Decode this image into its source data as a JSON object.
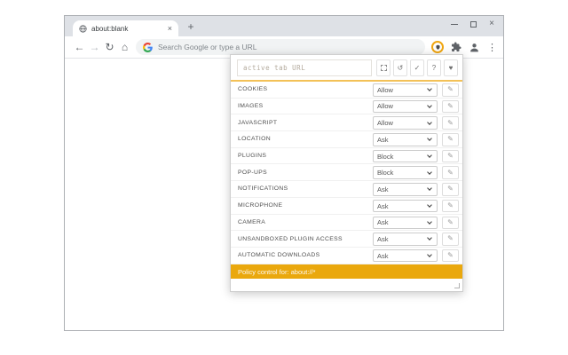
{
  "window": {
    "tab": {
      "title": "about:blank",
      "close_glyph": "×",
      "new_tab_glyph": "+"
    },
    "controls": {
      "close_glyph": "×"
    },
    "toolbar": {
      "back_glyph": "←",
      "forward_glyph": "→",
      "reload_glyph": "↻",
      "home_glyph": "⌂",
      "omnibox_placeholder": "Search Google or type a URL",
      "menu_glyph": "⋮"
    }
  },
  "popup": {
    "url_input": {
      "value": "",
      "placeholder": "active tab URL"
    },
    "header_buttons": {
      "reset_glyph": "↺",
      "confirm_glyph": "✓",
      "help_glyph": "?",
      "favorite_glyph": "♥"
    },
    "rows": [
      {
        "id": "cookies",
        "label": "COOKIES",
        "value": "Allow"
      },
      {
        "id": "images",
        "label": "IMAGES",
        "value": "Allow"
      },
      {
        "id": "javascript",
        "label": "JAVASCRIPT",
        "value": "Allow"
      },
      {
        "id": "location",
        "label": "LOCATION",
        "value": "Ask"
      },
      {
        "id": "plugins",
        "label": "PLUGINS",
        "value": "Block"
      },
      {
        "id": "popups",
        "label": "POP-UPS",
        "value": "Block"
      },
      {
        "id": "notifications",
        "label": "NOTIFICATIONS",
        "value": "Ask"
      },
      {
        "id": "microphone",
        "label": "MICROPHONE",
        "value": "Ask"
      },
      {
        "id": "camera",
        "label": "CAMERA",
        "value": "Ask"
      },
      {
        "id": "unsandboxed-plugin-access",
        "label": "UNSANDBOXED PLUGIN ACCESS",
        "value": "Ask"
      },
      {
        "id": "automatic-downloads",
        "label": "AUTOMATIC DOWNLOADS",
        "value": "Ask"
      }
    ],
    "edit_glyph": "✎",
    "banner": {
      "text": "Policy control for: about://*",
      "color": "#eaa80d"
    }
  }
}
